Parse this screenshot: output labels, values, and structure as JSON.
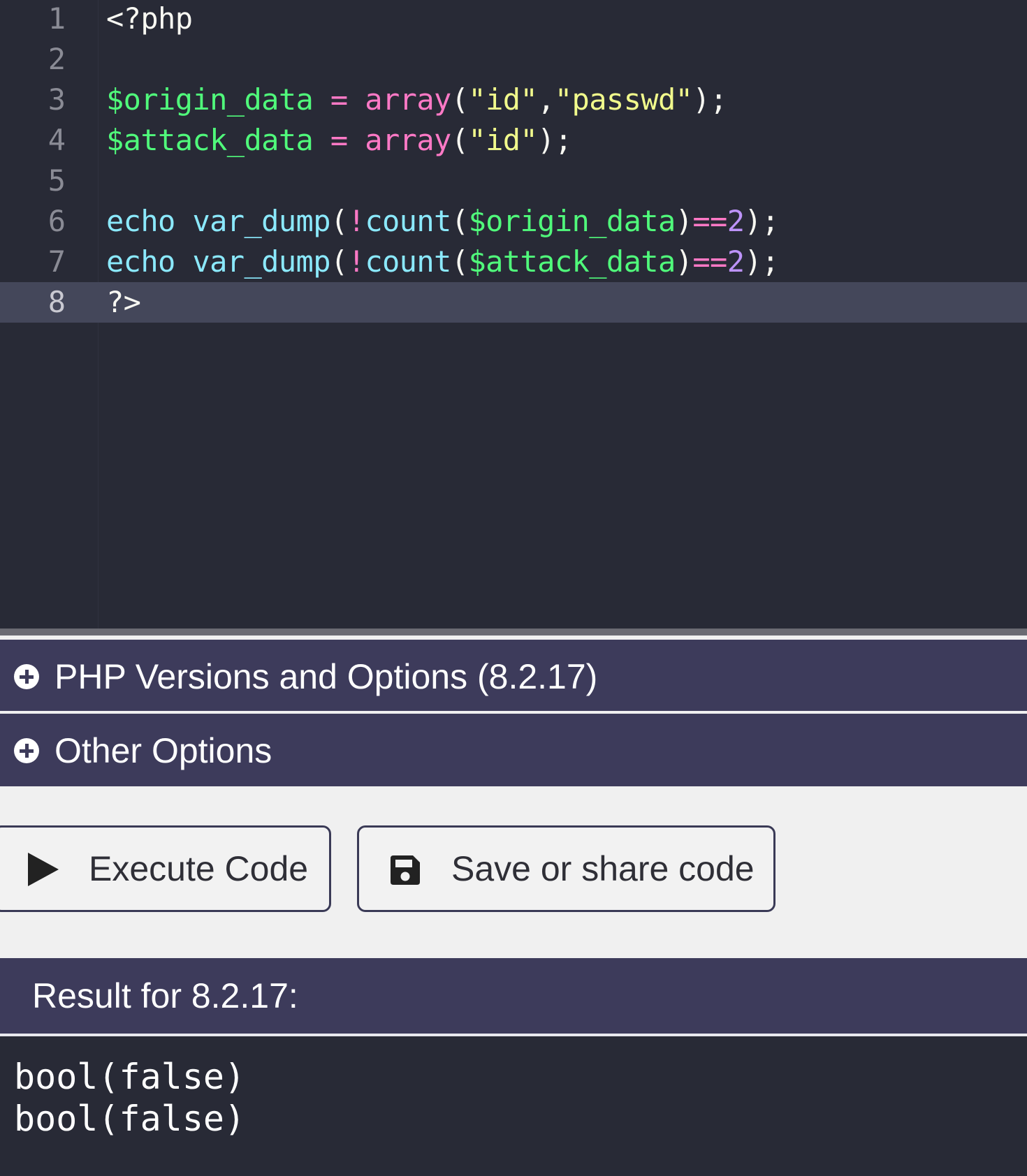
{
  "editor": {
    "lines": [
      {
        "number": "1",
        "tokens": [
          {
            "text": "<?php",
            "type": "plain"
          }
        ]
      },
      {
        "number": "2",
        "tokens": []
      },
      {
        "number": "3",
        "tokens": [
          {
            "text": "$origin_data",
            "type": "var"
          },
          {
            "text": " ",
            "type": "plain"
          },
          {
            "text": "=",
            "type": "op"
          },
          {
            "text": " ",
            "type": "plain"
          },
          {
            "text": "array",
            "type": "fn"
          },
          {
            "text": "(",
            "type": "plain"
          },
          {
            "text": "\"id\"",
            "type": "str"
          },
          {
            "text": ",",
            "type": "plain"
          },
          {
            "text": "\"passwd\"",
            "type": "str"
          },
          {
            "text": ");",
            "type": "plain"
          }
        ]
      },
      {
        "number": "4",
        "tokens": [
          {
            "text": "$attack_data",
            "type": "var"
          },
          {
            "text": " ",
            "type": "plain"
          },
          {
            "text": "=",
            "type": "op"
          },
          {
            "text": " ",
            "type": "plain"
          },
          {
            "text": "array",
            "type": "fn"
          },
          {
            "text": "(",
            "type": "plain"
          },
          {
            "text": "\"id\"",
            "type": "str"
          },
          {
            "text": ");",
            "type": "plain"
          }
        ]
      },
      {
        "number": "5",
        "tokens": []
      },
      {
        "number": "6",
        "tokens": [
          {
            "text": "echo",
            "type": "kw"
          },
          {
            "text": " ",
            "type": "plain"
          },
          {
            "text": "var_dump",
            "type": "builtin"
          },
          {
            "text": "(",
            "type": "plain"
          },
          {
            "text": "!",
            "type": "op"
          },
          {
            "text": "count",
            "type": "builtin"
          },
          {
            "text": "(",
            "type": "plain"
          },
          {
            "text": "$origin_data",
            "type": "var"
          },
          {
            "text": ")",
            "type": "plain"
          },
          {
            "text": "==",
            "type": "op"
          },
          {
            "text": "2",
            "type": "num"
          },
          {
            "text": ");",
            "type": "plain"
          }
        ]
      },
      {
        "number": "7",
        "tokens": [
          {
            "text": "echo",
            "type": "kw"
          },
          {
            "text": " ",
            "type": "plain"
          },
          {
            "text": "var_dump",
            "type": "builtin"
          },
          {
            "text": "(",
            "type": "plain"
          },
          {
            "text": "!",
            "type": "op"
          },
          {
            "text": "count",
            "type": "builtin"
          },
          {
            "text": "(",
            "type": "plain"
          },
          {
            "text": "$attack_data",
            "type": "var"
          },
          {
            "text": ")",
            "type": "plain"
          },
          {
            "text": "==",
            "type": "op"
          },
          {
            "text": "2",
            "type": "num"
          },
          {
            "text": ");",
            "type": "plain"
          }
        ]
      },
      {
        "number": "8",
        "tokens": [
          {
            "text": "?>",
            "type": "plain"
          }
        ]
      }
    ],
    "active_line": "8"
  },
  "panels": {
    "versions": {
      "title": "PHP Versions and Options (8.2.17)",
      "icon": "plus-circle-icon"
    },
    "other": {
      "title": "Other Options",
      "icon": "plus-circle-icon"
    }
  },
  "buttons": {
    "execute": {
      "label": "Execute Code",
      "icon": "play-icon"
    },
    "save": {
      "label": "Save or share code",
      "icon": "floppy-disk-icon"
    }
  },
  "result": {
    "title": "Result for 8.2.17:",
    "output": [
      "bool(false)",
      "bool(false)"
    ]
  },
  "colors": {
    "editor_bg": "#282a36",
    "active_line_bg": "#44475a",
    "panel_bg": "#3d3b5b",
    "variable": "#50fa7b",
    "operator": "#ff79c6",
    "string": "#f1fa8c",
    "keyword": "#8be9fd",
    "number": "#bd93f9"
  }
}
